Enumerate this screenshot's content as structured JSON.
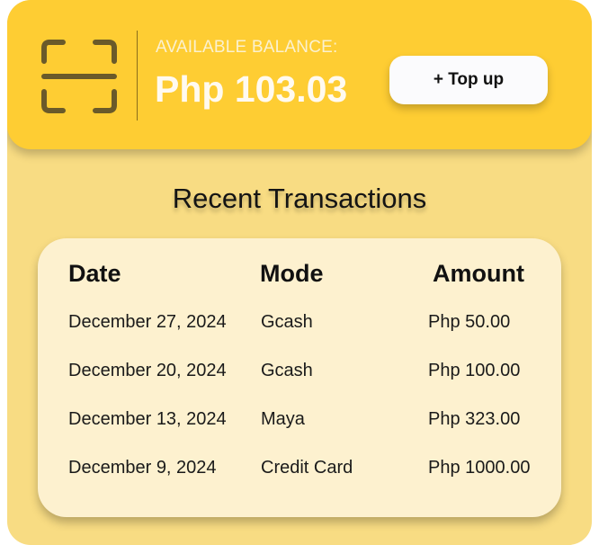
{
  "balance": {
    "label": "AVAILABLE BALANCE:",
    "value": "Php 103.03",
    "topup_label": "+ Top up",
    "scan_icon": "scan-frame-icon"
  },
  "transactions": {
    "title": "Recent Transactions",
    "headers": [
      "Date",
      "Mode",
      "Amount"
    ],
    "rows": [
      {
        "date": "December 27, 2024",
        "mode": "Gcash",
        "amount": "Php 50.00"
      },
      {
        "date": "December 20, 2024",
        "mode": "Gcash",
        "amount": "Php 100.00"
      },
      {
        "date": "December 13, 2024",
        "mode": "Maya",
        "amount": "Php 323.00"
      },
      {
        "date": "December 9, 2024",
        "mode": "Credit Card",
        "amount": "Php 1000.00"
      }
    ]
  },
  "colors": {
    "header_bg": "#fecd33",
    "card_bg": "#f8dc83",
    "panel_bg": "#fdf1cf",
    "button_bg": "#fbfbfd"
  }
}
